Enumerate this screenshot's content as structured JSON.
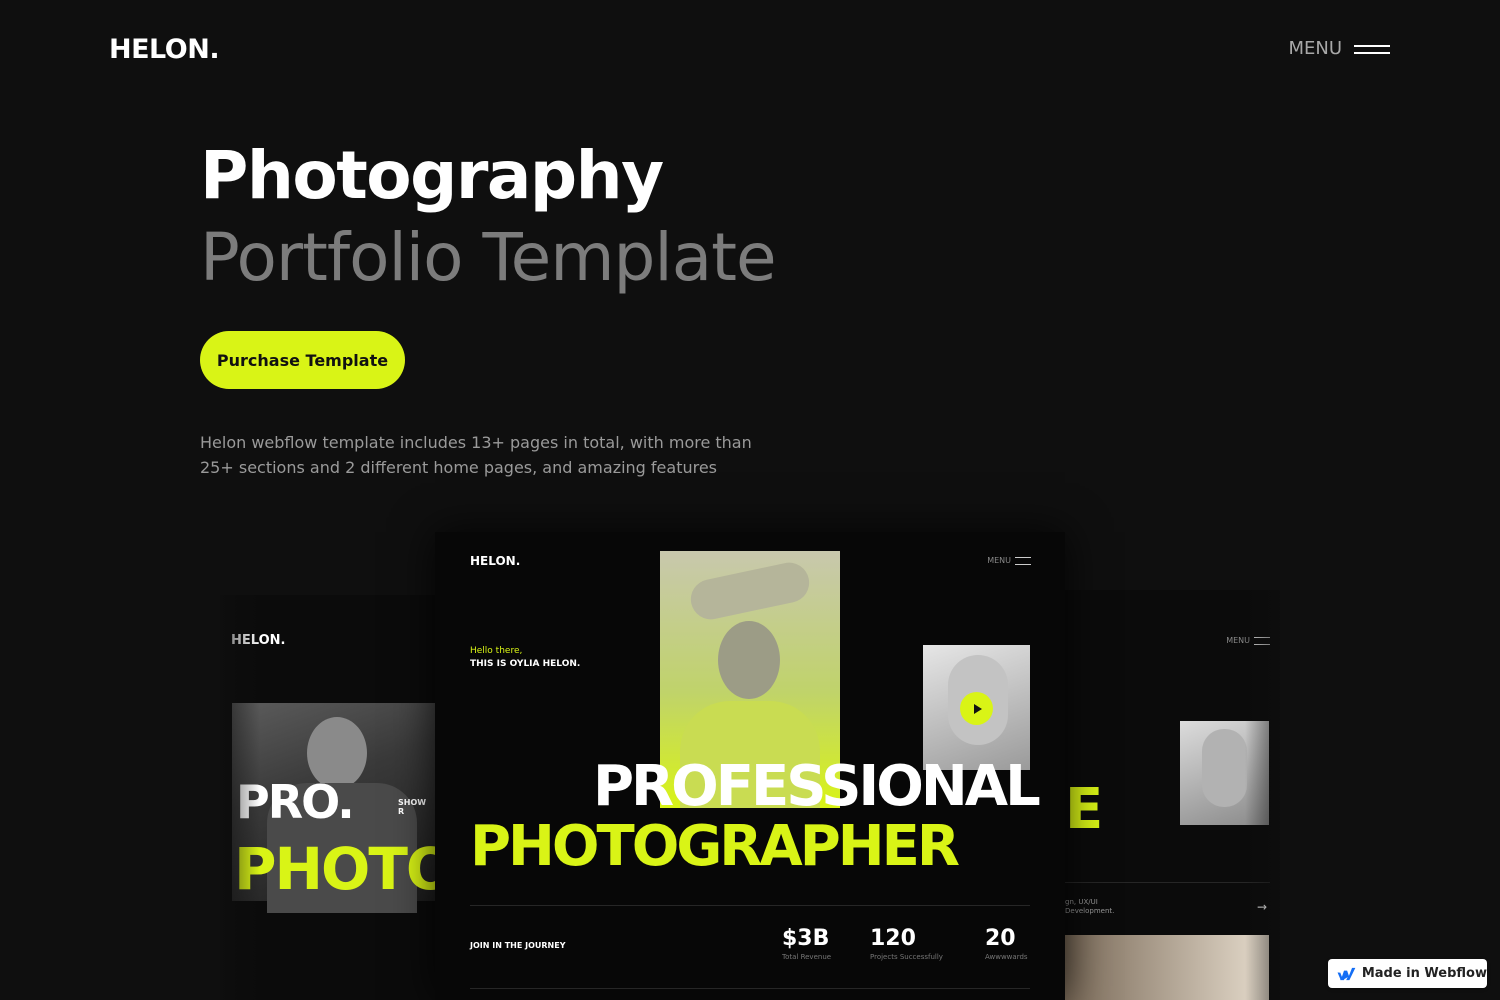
{
  "nav": {
    "logo": "HELON.",
    "menu_label": "MENU"
  },
  "hero": {
    "title": "Photography",
    "subtitle": "Portfolio Template",
    "cta_label": "Purchase Template",
    "description": "Helon webflow template includes 13+ pages in total, with more than 25+ sections and 2 different home pages, and amazing features"
  },
  "preview_left": {
    "logo": "HELON.",
    "headline_1": "PRO.",
    "headline_2": "PHOTO",
    "side_label": "SHOW R"
  },
  "preview_main": {
    "logo": "HELON.",
    "menu_label": "MENU",
    "greeting": "Hello there,",
    "intro": "THIS IS OYLIA HELON.",
    "headline_1": "PROFESSIONAL",
    "headline_2": "PHOTOGRAPHER",
    "join_label": "JOIN IN THE JOURNEY",
    "stats": [
      {
        "value": "$3B",
        "label": "Total Revenue"
      },
      {
        "value": "120",
        "label": "Projects Successfully"
      },
      {
        "value": "20",
        "label": "Awwwwards"
      }
    ]
  },
  "preview_right": {
    "menu_label": "MENU",
    "headline_fragment": "E",
    "text_line_1": "gn, UX/UI",
    "text_line_2": "Development.",
    "arrow": "→"
  },
  "badge": {
    "label": "Made in Webflow"
  },
  "colors": {
    "background": "#0f0f0f",
    "accent": "#d9f416",
    "muted_text": "#7c7c7c"
  },
  "icons": [
    "hamburger-menu-icon",
    "play-icon",
    "arrow-right-icon",
    "webflow-logo-icon"
  ]
}
